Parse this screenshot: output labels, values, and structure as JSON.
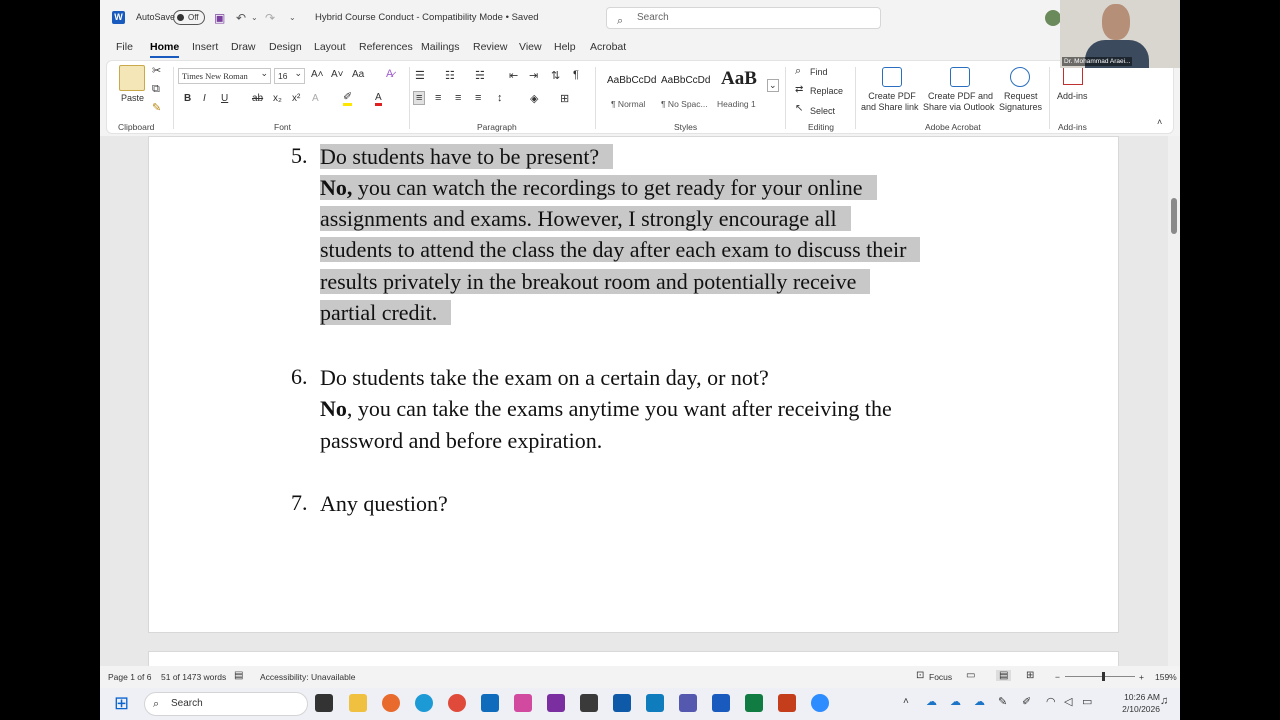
{
  "titlebar": {
    "autosave_label": "AutoSave",
    "autosave_state": "Off",
    "doc_title": "Hybrid Course Conduct  -  Compatibility Mode • Saved",
    "search_placeholder": "Search"
  },
  "tabs": [
    "File",
    "Home",
    "Insert",
    "Draw",
    "Design",
    "Layout",
    "References",
    "Mailings",
    "Review",
    "View",
    "Help",
    "Acrobat"
  ],
  "ribbon": {
    "clipboard": {
      "paste": "Paste",
      "label": "Clipboard"
    },
    "font": {
      "name": "Times New Roman",
      "size": "16",
      "label": "Font",
      "case": "Aa"
    },
    "paragraph": {
      "label": "Paragraph"
    },
    "styles": {
      "label": "Styles",
      "items": [
        {
          "sample": "AaBbCcDd",
          "name": "¶ Normal"
        },
        {
          "sample": "AaBbCcDd",
          "name": "¶ No Spac..."
        },
        {
          "sample": "AaB",
          "name": "Heading 1"
        }
      ]
    },
    "editing": {
      "find": "Find",
      "replace": "Replace",
      "select": "Select",
      "label": "Editing"
    },
    "acrobat": {
      "create_pdf_line1": "Create PDF",
      "create_pdf_line2": "and Share link",
      "share_outlook_line1": "Create PDF and",
      "share_outlook_line2": "Share via Outlook",
      "signatures_line1": "Request",
      "signatures_line2": "Signatures",
      "label": "Adobe Acrobat"
    },
    "addins": {
      "button": "Add-ins",
      "label": "Add-ins"
    }
  },
  "document": {
    "q5": {
      "num": "5.",
      "question": "Do students have to be present?",
      "answer_bold": "No,",
      "answer_lines": [
        " you can watch the recordings to get ready for your online",
        "assignments and exams. However, I strongly encourage all",
        "students to attend the class the day after each exam to discuss their",
        "results privately in the breakout room and potentially receive",
        "partial credit."
      ]
    },
    "q6": {
      "num": "6.",
      "question": "Do students take the exam on a certain day, or not?",
      "answer_bold": "No",
      "answer_lines": [
        ", you can take the exams anytime you want after receiving the",
        "password and before expiration."
      ]
    },
    "q7": {
      "num": "7.",
      "question": "Any question?"
    }
  },
  "statusbar": {
    "page": "Page 1 of 6",
    "words": "51 of 1473 words",
    "accessibility": "Accessibility: Unavailable",
    "focus": "Focus",
    "zoom": "159%"
  },
  "webcam": {
    "name": "Dr. Mohammad Araei..."
  },
  "taskbar": {
    "search": "Search",
    "time": "10:26 AM",
    "date": "2/10/2026"
  }
}
